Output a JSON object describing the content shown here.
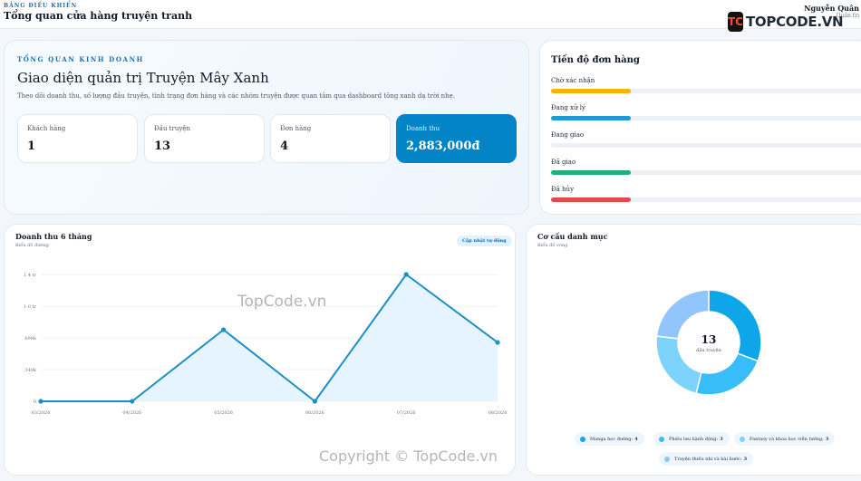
{
  "header": {
    "eyebrow": "BẢNG ĐIỀU KHIỂN",
    "title": "Tổng quan cửa hàng truyện tranh",
    "user_name": "Nguyễn Quân",
    "user_role": "Quản trị"
  },
  "logo": {
    "mark": "TC",
    "text": "TOPCODE.VN"
  },
  "hero": {
    "eyebrow": "TỔNG QUAN KINH DOANH",
    "title": "Giao diện quản trị Truyện Mây Xanh",
    "description": "Theo dõi doanh thu, số lượng đầu truyện, tình trạng đơn hàng và các nhóm truyện được quan tâm qua dashboard tông xanh dạ trời nhẹ.",
    "stats": [
      {
        "label": "Khách hàng",
        "value": "1"
      },
      {
        "label": "Đầu truyện",
        "value": "13"
      },
      {
        "label": "Đơn hàng",
        "value": "4"
      },
      {
        "label": "Doanh thu",
        "value": "2,883,000đ"
      }
    ]
  },
  "order_progress": {
    "title": "Tiến độ đơn hàng",
    "rows": [
      {
        "label": "Chờ xác nhận",
        "fraction": 0.25,
        "color": "#f4b400"
      },
      {
        "label": "Đang xử lý",
        "fraction": 0.25,
        "color": "#1d9bd7"
      },
      {
        "label": "Đang giao",
        "fraction": 0,
        "color": "#1d9bd7"
      },
      {
        "label": "Đã giao",
        "fraction": 0.25,
        "color": "#1fb07a"
      },
      {
        "label": "Đã hủy",
        "fraction": 0.25,
        "color": "#e5484d"
      }
    ]
  },
  "revenue": {
    "title": "Doanh thu 6 tháng",
    "subtitle": "Biểu đồ đường",
    "badge": "Cập nhật tự động"
  },
  "category": {
    "title": "Cơ cấu danh mục",
    "subtitle": "Biểu đồ vòng",
    "center_value": "13",
    "center_label": "đầu truyện",
    "legend": [
      {
        "label": "Manga học đường:",
        "value": "4",
        "color": "#0ea5e9"
      },
      {
        "label": "Phiêu lưu hành động:",
        "value": "3",
        "color": "#38bdf8"
      },
      {
        "label": "Fantasy và khoa học viễn tưởng:",
        "value": "3",
        "color": "#7dd3fc"
      },
      {
        "label": "Truyện thiếu nhi và hài hước:",
        "value": "3",
        "color": "#93c5fd"
      }
    ]
  },
  "chart_data": [
    {
      "type": "line",
      "title": "Doanh thu 6 tháng",
      "categories": [
        "03/2026",
        "04/2026",
        "05/2026",
        "06/2026",
        "07/2026",
        "08/2026"
      ],
      "series": [
        {
          "values": [
            0,
            0,
            790000,
            0,
            1400000,
            650000
          ]
        }
      ],
      "ytick_labels": [
        "0",
        "349k",
        "699k",
        "1.0 tr",
        "1.4 tr"
      ],
      "ytick_values": [
        0,
        349000,
        699000,
        1048000,
        1398000
      ],
      "ylim": [
        0,
        1400000
      ],
      "color": "#1e8fc4",
      "fill": "#e0f2fe",
      "grid": true
    },
    {
      "type": "pie",
      "title": "Cơ cấu danh mục",
      "labels": [
        "Manga học đường",
        "Phiêu lưu hành động",
        "Fantasy và khoa học viễn tưởng",
        "Truyện thiếu nhi và hài hước"
      ],
      "values": [
        4,
        3,
        3,
        3
      ],
      "colors": [
        "#0ea5e9",
        "#38bdf8",
        "#7dd3fc",
        "#93c5fd"
      ]
    }
  ],
  "watermarks": {
    "center": "TopCode.vn",
    "bottom": "Copyright © TopCode.vn"
  }
}
